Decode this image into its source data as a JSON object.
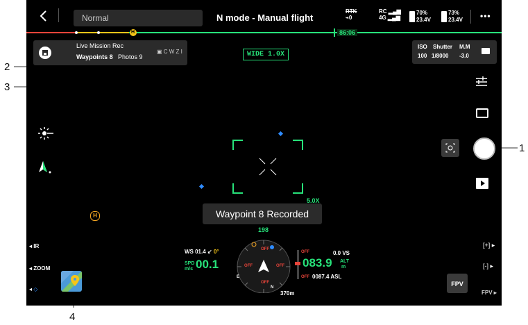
{
  "top_bar": {
    "mode_select": "Normal",
    "flight_mode": "N mode - Manual flight",
    "rtk_label": "RTK",
    "rtk_sats": "0",
    "rc_label": "RC",
    "signal_label": "4G",
    "battery1_pct": "70%",
    "battery1_v": "23.4V",
    "battery2_pct": "73%",
    "battery2_v": "23.4V",
    "more": "•••"
  },
  "progress": {
    "time": "86:06",
    "home_marker": "H"
  },
  "mission_panel": {
    "title": "Live Mission Rec",
    "waypoints": "Waypoints 8",
    "photos": "Photos 9",
    "lens_tags": "C W Z I"
  },
  "camera": {
    "zoom_badge": "WIDE 1.0X",
    "iso_label": "ISO",
    "iso_value": "100",
    "shutter_label": "Shutter",
    "shutter_value": "1/8000",
    "mm_label": "M.M",
    "mm_value": "-3.0"
  },
  "toast": "Waypoint 8 Recorded",
  "left_controls": {
    "ir": "IR",
    "zoom": "ZOOM",
    "home_marker": "H"
  },
  "telemetry": {
    "heading": "198",
    "ws": "WS 01.4",
    "ws_angle": "0°",
    "spd_label": "SPD\nm/s",
    "spd_value": "00.1",
    "alt_value": "083.9",
    "alt_label": "ALT\nm",
    "vs": "0.0 VS",
    "asl": "0087.4 ASL",
    "distance": "370m",
    "off1": "OFF",
    "off2": "OFF",
    "off3": "OFF",
    "off4": "OFF",
    "compass_n": "N",
    "compass_e": "E",
    "peek_zoom": "5.0X"
  },
  "right_controls": {
    "fpv_button": "FPV",
    "fpv_label": "FPV",
    "zoom_in": "[+]",
    "zoom_out": "[-]"
  },
  "callouts": [
    "1",
    "2",
    "3",
    "4"
  ]
}
